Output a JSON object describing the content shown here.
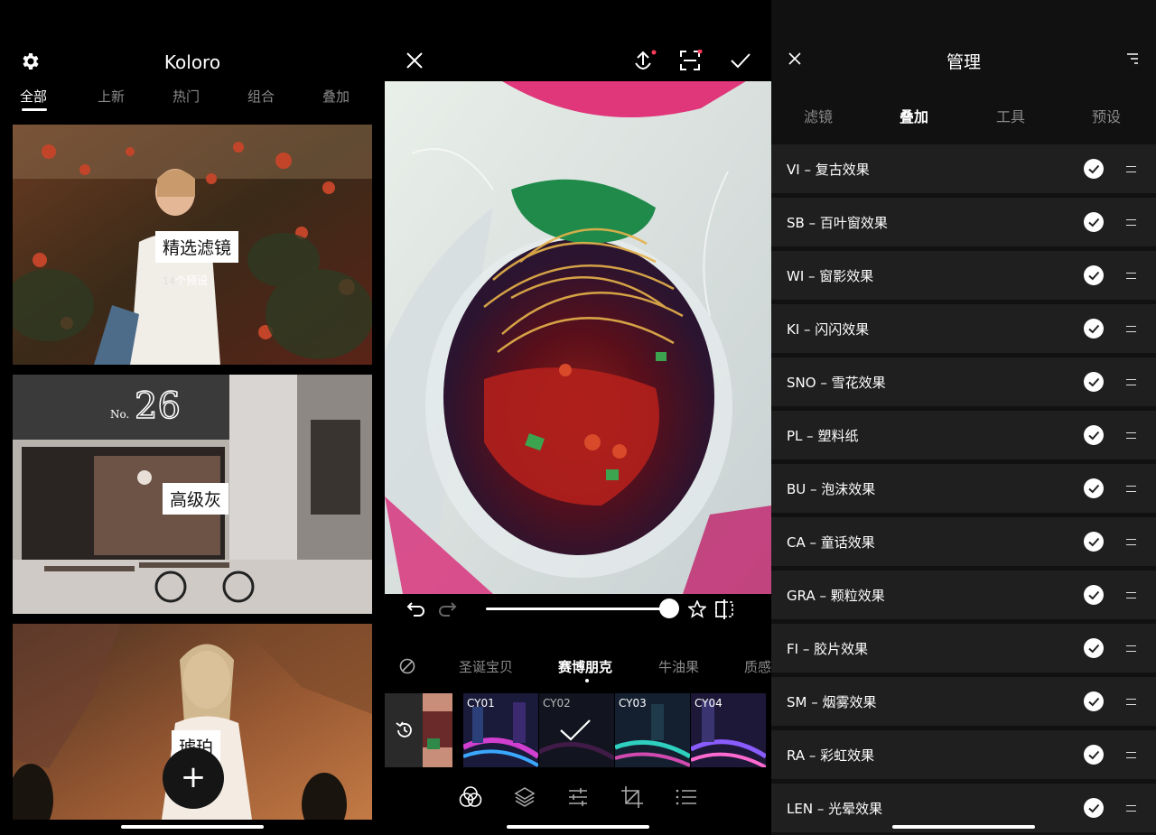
{
  "left_panel": {
    "app_title": "Koloro",
    "settings_icon": "gear-icon",
    "tabs": [
      {
        "label": "全部",
        "active": true
      },
      {
        "label": "上新",
        "active": false
      },
      {
        "label": "热门",
        "active": false
      },
      {
        "label": "组合",
        "active": false
      },
      {
        "label": "叠加",
        "active": false
      }
    ],
    "cards": [
      {
        "title": "精选滤镜",
        "subtitle": "个预设",
        "subtitle_prefix_partial": "14"
      },
      {
        "title": "高级灰"
      },
      {
        "title": "琥珀"
      }
    ],
    "fab_icon": "plus-icon",
    "fab_symbol": "+"
  },
  "editor": {
    "top_icons": [
      "close-icon",
      "share-icon",
      "compare-frame-icon",
      "confirm-check-icon"
    ],
    "slider_value": 0.95,
    "filter_categories": [
      {
        "label": "圣诞宝贝",
        "active": false
      },
      {
        "label": "赛博朋克",
        "active": true
      },
      {
        "label": "牛油果",
        "active": false
      },
      {
        "label": "质感",
        "active": false
      }
    ],
    "thumbnails": [
      {
        "label": "CY01",
        "selected": false
      },
      {
        "label": "CY02",
        "selected": true
      },
      {
        "label": "CY03",
        "selected": false
      },
      {
        "label": "CY04",
        "selected": false
      }
    ],
    "bottom_tools": [
      "filter-circles-icon",
      "layers-icon",
      "adjust-sliders-icon",
      "crop-icon",
      "list-icon"
    ]
  },
  "manage": {
    "title": "管理",
    "tabs": [
      {
        "label": "滤镜",
        "active": false
      },
      {
        "label": "叠加",
        "active": true
      },
      {
        "label": "工具",
        "active": false
      },
      {
        "label": "预设",
        "active": false
      }
    ],
    "items": [
      {
        "label": "VI – 复古效果",
        "enabled": true
      },
      {
        "label": "SB – 百叶窗效果",
        "enabled": true
      },
      {
        "label": "WI – 窗影效果",
        "enabled": true
      },
      {
        "label": "KI – 闪闪效果",
        "enabled": true
      },
      {
        "label": "SNO – 雪花效果",
        "enabled": true
      },
      {
        "label": "PL – 塑料纸",
        "enabled": true
      },
      {
        "label": "BU – 泡沫效果",
        "enabled": true
      },
      {
        "label": "CA – 童话效果",
        "enabled": true
      },
      {
        "label": "GRA – 颗粒效果",
        "enabled": true
      },
      {
        "label": "FI – 胶片效果",
        "enabled": true
      },
      {
        "label": "SM – 烟雾效果",
        "enabled": true
      },
      {
        "label": "RA – 彩虹效果",
        "enabled": true
      },
      {
        "label": "LEN – 光晕效果",
        "enabled": true
      }
    ]
  },
  "colors": {
    "background": "#000000",
    "list_row": "#1f1f1f",
    "inactive_text": "#8a8a8a",
    "accent_white": "#ffffff"
  }
}
